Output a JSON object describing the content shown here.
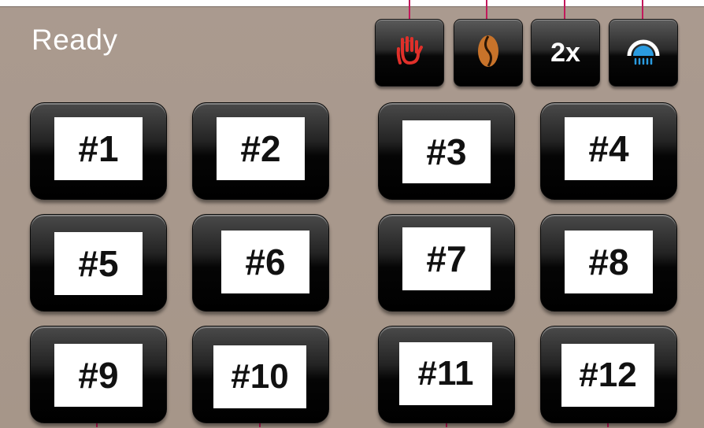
{
  "status": {
    "text": "Ready"
  },
  "function_buttons": [
    {
      "name": "stop-button",
      "icon": "stop-hand-icon",
      "color": "#e0302a",
      "label": ""
    },
    {
      "name": "bean-button",
      "icon": "coffee-bean-icon",
      "color": "#c8732a",
      "label": ""
    },
    {
      "name": "double-button",
      "icon": "",
      "color": "#ffffff",
      "label": "2x"
    },
    {
      "name": "rinse-button",
      "icon": "rinse-shower-icon",
      "color": "#2a9be0",
      "label": ""
    }
  ],
  "drinks": [
    {
      "label": "#1"
    },
    {
      "label": "#2"
    },
    {
      "label": "#3"
    },
    {
      "label": "#4"
    },
    {
      "label": "#5"
    },
    {
      "label": "#6"
    },
    {
      "label": "#7"
    },
    {
      "label": "#8"
    },
    {
      "label": "#9"
    },
    {
      "label": "#10"
    },
    {
      "label": "#11"
    },
    {
      "label": "#12"
    }
  ],
  "colors": {
    "background": "#a9998e",
    "callout": "#c2185b",
    "button": "#000000"
  }
}
